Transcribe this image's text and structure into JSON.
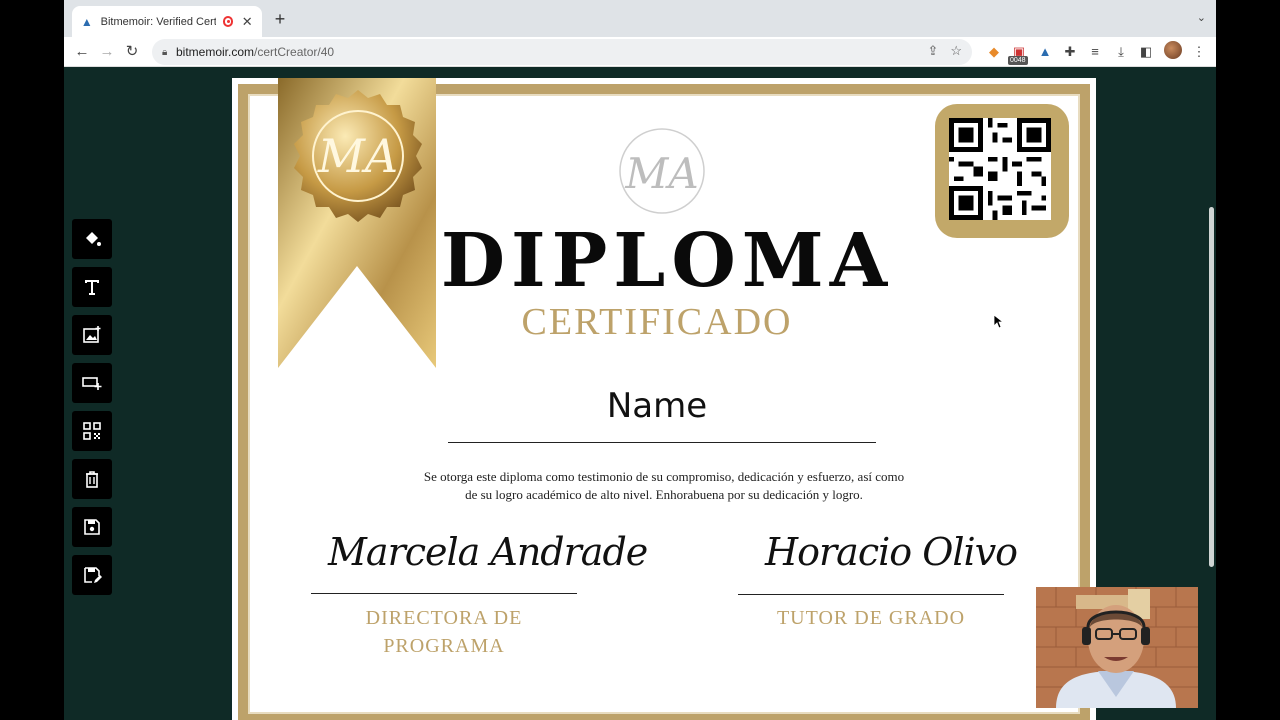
{
  "tab": {
    "title": "Bitmemoir: Verified Certifi",
    "close_glyph": "✕",
    "new_tab_glyph": "+"
  },
  "address_bar": {
    "host": "bitmemoir.com",
    "path": "/certCreator/40"
  },
  "extension_badge": "0048",
  "editor_tools": [
    {
      "name": "fill-color-icon"
    },
    {
      "name": "text-icon"
    },
    {
      "name": "add-image-icon"
    },
    {
      "name": "add-field-icon"
    },
    {
      "name": "qr-code-icon"
    },
    {
      "name": "delete-icon"
    },
    {
      "name": "save-icon"
    },
    {
      "name": "save-as-icon"
    }
  ],
  "certificate": {
    "title": "DIPLOMA",
    "subtitle": "CERTIFICADO",
    "recipient_placeholder": "Name",
    "body_line_1": "Se otorga este diploma como testimonio de su compromiso, dedicación y esfuerzo, así como",
    "body_line_2": "de su logro académico de alto nivel. Enhorabuena por su dedicación y logro.",
    "signatory_left": {
      "signature": "Marcela Andrade",
      "role_line_1": "DIRECTORA DE",
      "role_line_2": "PROGRAMA"
    },
    "signatory_right": {
      "signature": "Horacio Olivo",
      "role_line_1": "TUTOR DE GRADO"
    },
    "accent_color": "#bda26a"
  }
}
